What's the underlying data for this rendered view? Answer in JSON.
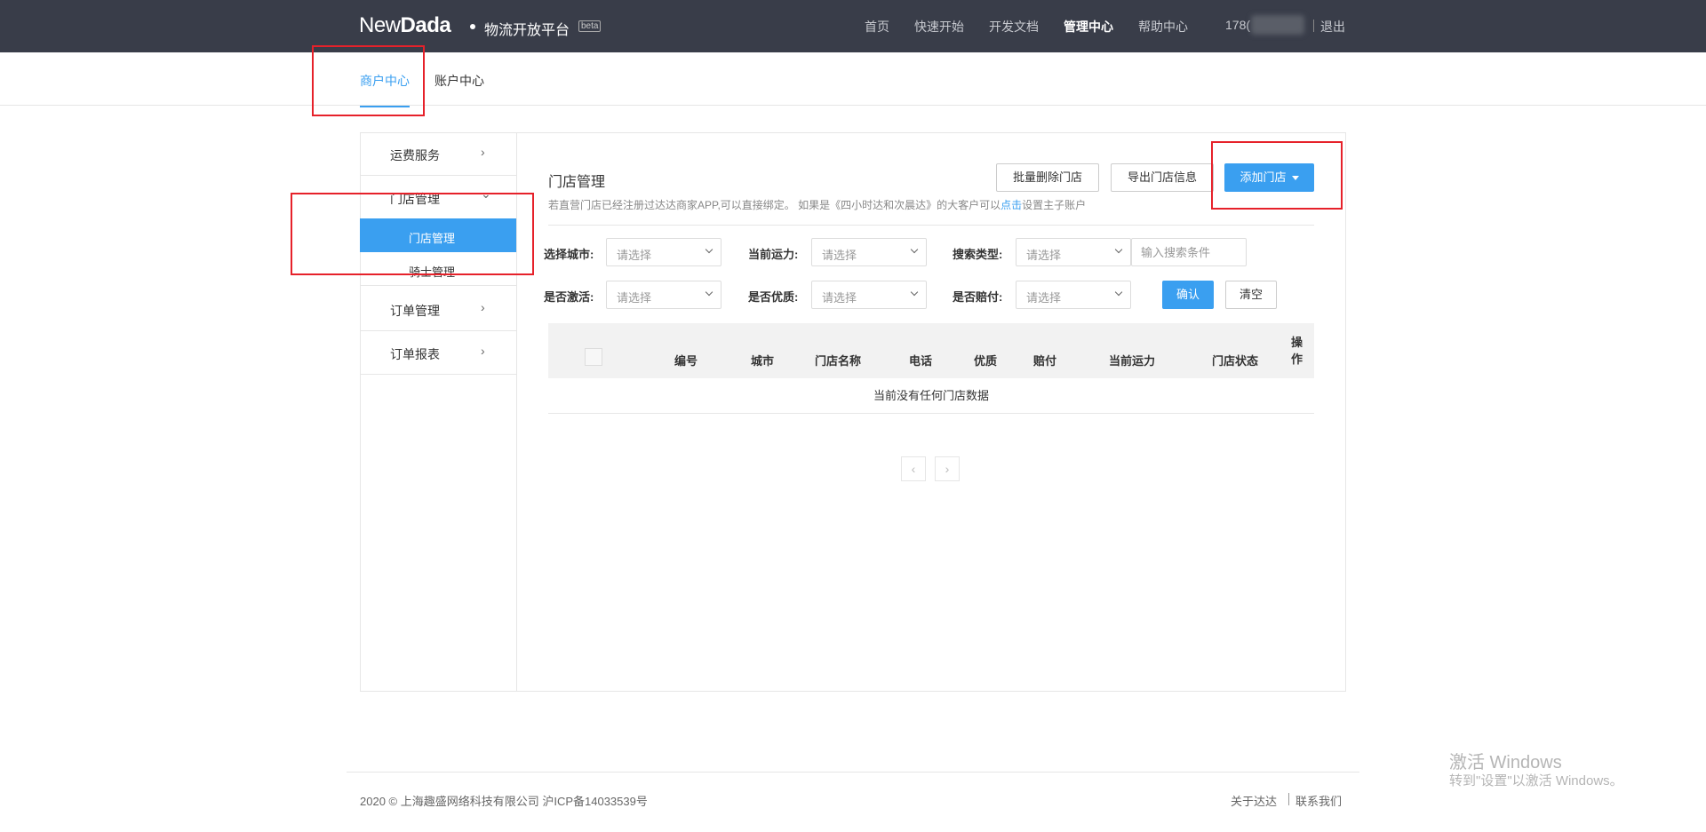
{
  "header": {
    "logo_new": "New",
    "logo_dada": "Dada",
    "subtitle": "物流开放平台",
    "beta": "beta",
    "nav": [
      "首页",
      "快速开始",
      "开发文档",
      "管理中心",
      "帮助中心"
    ],
    "user_partial": "178(",
    "logout": "退出"
  },
  "tabs": {
    "merchant_center": "商户中心",
    "account_center": "账户中心"
  },
  "sidebar": {
    "shipping_service": "运费服务",
    "store_mgmt": "门店管理",
    "store_mgmt_sub": "门店管理",
    "rider_mgmt": "骑士管理",
    "order_mgmt": "订单管理",
    "order_report": "订单报表",
    "chevron": "›",
    "chevron_down": "⌄"
  },
  "content": {
    "title": "门店管理",
    "hint_prefix": "若直营门店已经注册过达达商家APP,可以直接绑定。 如果是《四小时达和次晨达》的大客户可以",
    "hint_link": "点击",
    "hint_suffix": "设置主子账户",
    "btn_batch_delete": "批量删除门店",
    "btn_export": "导出门店信息",
    "btn_add": "添加门店"
  },
  "filters": {
    "city_label": "选择城市:",
    "capacity_label": "当前运力:",
    "search_type_label": "搜索类型:",
    "activated_label": "是否激活:",
    "quality_label": "是否优质:",
    "compensation_label": "是否赔付:",
    "select_placeholder": "请选择",
    "search_placeholder": "输入搜索条件",
    "confirm": "确认",
    "clear": "清空"
  },
  "table": {
    "columns": [
      "编号",
      "城市",
      "门店名称",
      "电话",
      "优质",
      "赔付",
      "当前运力",
      "门店状态"
    ],
    "op_col_1": "操",
    "op_col_2": "作",
    "empty": "当前没有任何门店数据"
  },
  "pager": {
    "prev": "‹",
    "next": "›"
  },
  "footer": {
    "copyright": "2020 © 上海趣盛网络科技有限公司 沪ICP备14033539号",
    "about": "关于达达",
    "contact": "联系我们"
  },
  "watermark": {
    "line1": "激活 Windows",
    "line2": "转到\"设置\"以激活 Windows。"
  },
  "colors": {
    "accent": "#3a9ff0",
    "topbar": "#393d49",
    "highlight": "#e6212a"
  }
}
